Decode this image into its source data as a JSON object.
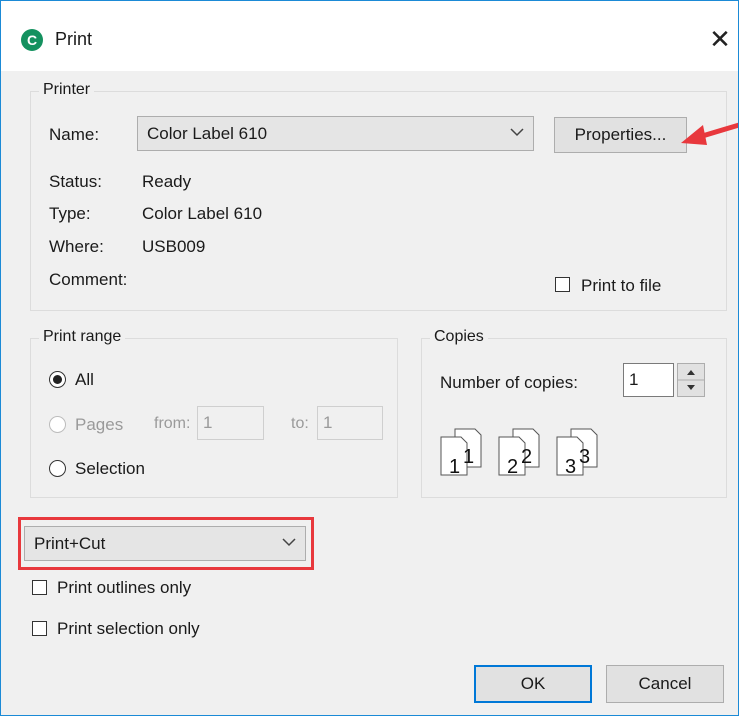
{
  "window": {
    "title": "Print",
    "app_icon_letter": "C"
  },
  "printer": {
    "group_label": "Printer",
    "name_label": "Name:",
    "name_value": "Color Label 610",
    "properties_button": "Properties...",
    "status_label": "Status:",
    "status_value": "Ready",
    "type_label": "Type:",
    "type_value": "Color Label 610",
    "where_label": "Where:",
    "where_value": "USB009",
    "comment_label": "Comment:",
    "print_to_file_label": "Print to file",
    "print_to_file_checked": false
  },
  "print_range": {
    "group_label": "Print range",
    "all_label": "All",
    "pages_label": "Pages",
    "from_label": "from:",
    "from_value": "1",
    "to_label": "to:",
    "to_value": "1",
    "selection_label": "Selection",
    "selected": "All"
  },
  "copies": {
    "group_label": "Copies",
    "number_label": "Number of copies:",
    "number_value": "1",
    "collate_digits": [
      "1",
      "1",
      "2",
      "2",
      "3",
      "3"
    ]
  },
  "mode_select": {
    "value": "Print+Cut",
    "highlight_color": "#e8383d"
  },
  "options": {
    "print_outlines_only": "Print outlines only",
    "print_selection_only": "Print selection only"
  },
  "buttons": {
    "ok": "OK",
    "cancel": "Cancel"
  },
  "colors": {
    "accent": "#0078d7",
    "arrow": "#e8383d",
    "window_border": "#1b8ad6"
  }
}
